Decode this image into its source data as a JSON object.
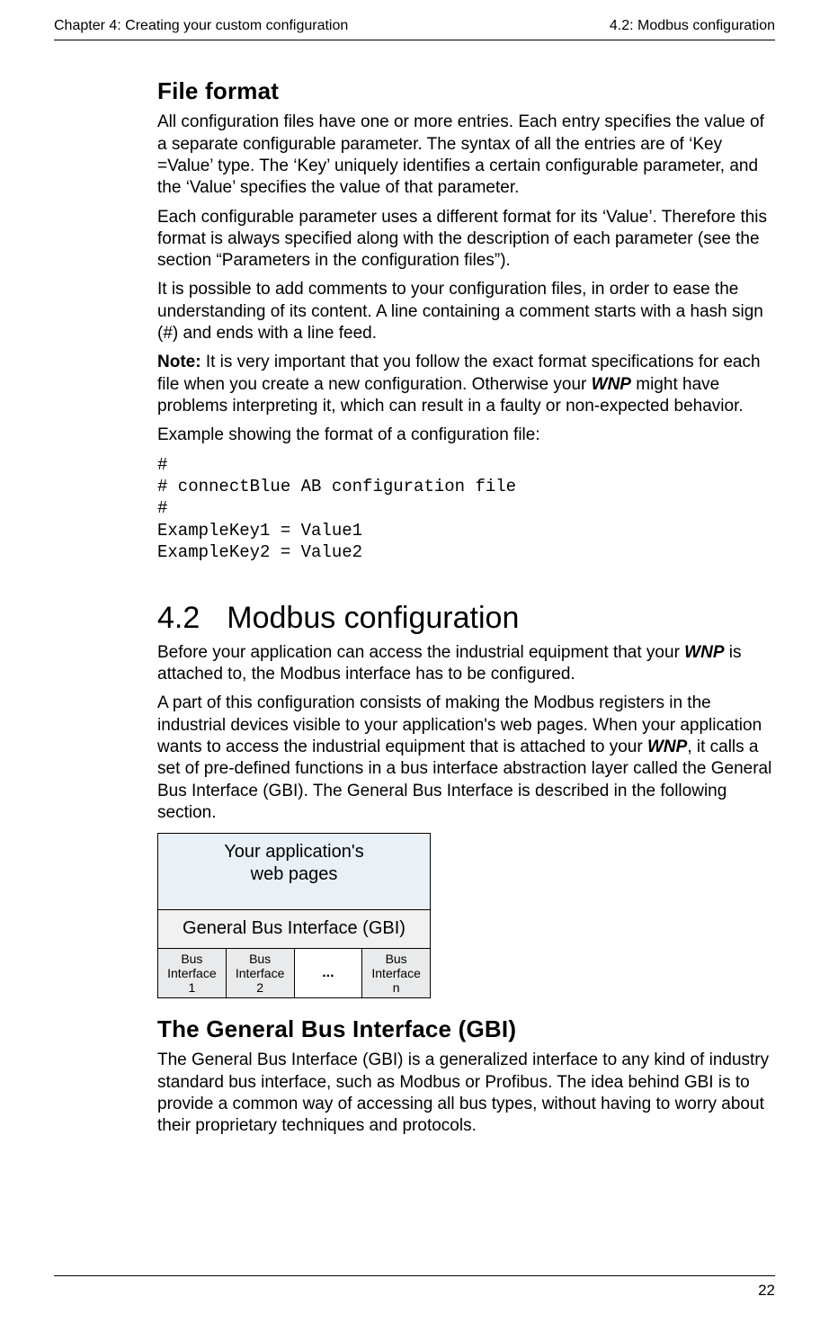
{
  "header": {
    "left": "Chapter 4: Creating your custom configuration",
    "right": "4.2: Modbus configuration"
  },
  "section1": {
    "title": "File format",
    "p1": "All configuration files have one or more entries. Each entry specifies the value of a separate configurable parameter. The syntax of all the entries are of ‘Key =Value’ type. The ‘Key’ uniquely identifies a certain configurable parameter, and the ‘Value’ specifies the value of that parameter.",
    "p2": "Each configurable parameter uses a different format for its ‘Value’. Therefore this format is always specified along with the description of each parameter (see the section “Parameters in the configuration files”).",
    "p3": "It is possible to add comments to your configuration files, in order to ease the understanding of its content. A line containing a comment starts with a hash sign (#) and ends with a line feed.",
    "note_label": "Note:",
    "p4a": " It is very important that you follow the exact format specifications for each file when you create a new configuration. Otherwise your ",
    "wnp": "WNP",
    "p4b": " might have problems interpreting it, which can result in a faulty or non-expected behavior.",
    "p5": "Example showing the format of a configuration file:",
    "code": "#\n# connectBlue AB configuration file\n#\nExampleKey1 = Value1\nExampleKey2 = Value2"
  },
  "section2": {
    "number": "4.2",
    "title": "Modbus configuration",
    "p1a": "Before your application can access the industrial equipment that your ",
    "p1b": " is attached to, the Modbus interface has to be configured.",
    "p2a": "A part of this configuration consists of making the Modbus registers in the industrial devices visible to your application's web pages. When your application wants to access the industrial equipment that is attached to your ",
    "p2b": ", it calls a set of pre-defined functions in a bus interface abstraction layer called the General Bus Interface (GBI). The General Bus Interface is described in the following section."
  },
  "diagram": {
    "top1": "Your application's",
    "top2": "web pages",
    "mid": "General Bus Interface (GBI)",
    "cells": {
      "c1a": "Bus",
      "c1b": "Interface",
      "c1c": "1",
      "c2a": "Bus",
      "c2b": "Interface",
      "c2c": "2",
      "dots": "...",
      "c4a": "Bus",
      "c4b": "Interface",
      "c4c": "n"
    }
  },
  "section3": {
    "title": "The General Bus Interface (GBI)",
    "p1": "The General Bus Interface (GBI) is a generalized interface to any kind of industry standard bus interface, such as Modbus or Profibus. The idea behind GBI is to provide a common way of accessing all bus types, without having to worry about their proprietary techniques and protocols."
  },
  "footer": {
    "page": "22"
  }
}
